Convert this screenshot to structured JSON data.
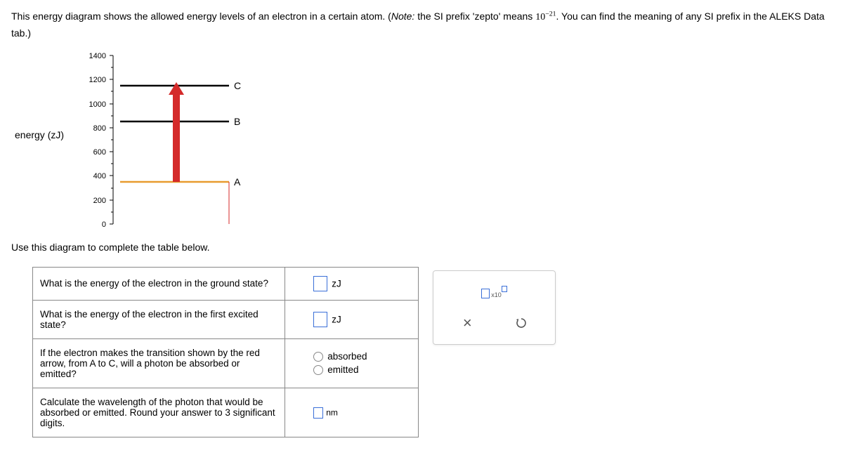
{
  "instruction_pre": "This energy diagram shows the allowed energy levels of an electron in a certain atom. (",
  "instruction_note_label": "Note:",
  "instruction_note_text": " the SI prefix 'zepto' means ",
  "instruction_base": "10",
  "instruction_exp": "−21",
  "instruction_post": ". You can find the meaning of any SI prefix in the ALEKS Data tab.)",
  "instruction2": "Use this diagram to complete the table below.",
  "ylabel": "energy (zJ)",
  "chart_data": {
    "type": "energy-level-diagram",
    "ylabel": "energy (zJ)",
    "ylim": [
      0,
      1400
    ],
    "yticks": [
      0,
      200,
      400,
      600,
      800,
      1000,
      1200,
      1400
    ],
    "levels": [
      {
        "label": "A",
        "energy": 350,
        "color": "orange"
      },
      {
        "label": "B",
        "energy": 850,
        "color": "black"
      },
      {
        "label": "C",
        "energy": 1150,
        "color": "black"
      }
    ],
    "transition_arrow": {
      "from": "A",
      "to": "C",
      "color": "red",
      "direction": "up"
    }
  },
  "table": {
    "rows": [
      {
        "q": "What is the energy of the electron in the ground state?",
        "unit": "zJ",
        "type": "value"
      },
      {
        "q": "What is the energy of the electron in the first excited state?",
        "unit": "zJ",
        "type": "value"
      },
      {
        "q": "If the electron makes the transition shown by the red arrow, from A to C, will a photon be absorbed or emitted?",
        "type": "radio",
        "options": [
          "absorbed",
          "emitted"
        ]
      },
      {
        "q": "Calculate the wavelength of the photon that would be absorbed or emitted. Round your answer to 3 significant digits.",
        "unit": "nm",
        "type": "value-sm"
      }
    ]
  },
  "toolbox": {
    "sci_sub": "x10",
    "close": "×",
    "reset": "↺"
  }
}
